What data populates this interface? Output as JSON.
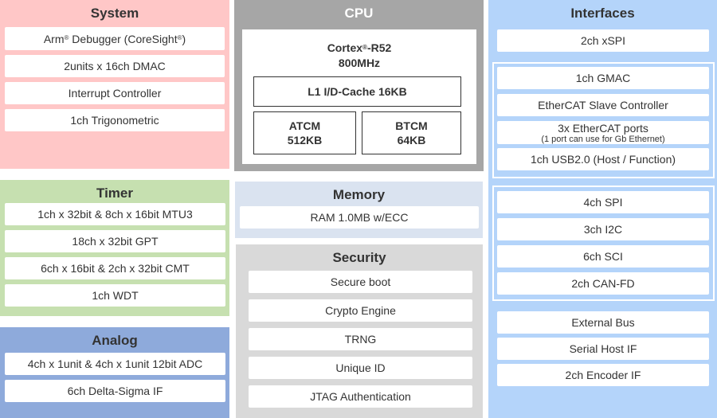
{
  "system": {
    "title": "System",
    "items": [
      {
        "text": "Arm",
        "sup1": "®",
        "rest": " Debugger (CoreSight",
        "sup2": "®",
        "end": ")"
      },
      {
        "label": "2units x 16ch DMAC"
      },
      {
        "label": "Interrupt Controller"
      },
      {
        "label": "1ch Trigonometric"
      }
    ],
    "color": "#ffc7c7"
  },
  "timer": {
    "title": "Timer",
    "items": [
      {
        "label": "1ch x 32bit & 8ch x 16bit MTU3"
      },
      {
        "label": "18ch x 32bit GPT"
      },
      {
        "label": "6ch x 16bit & 2ch x 32bit CMT"
      },
      {
        "label": "1ch WDT"
      }
    ],
    "color": "#c6e0b0"
  },
  "analog": {
    "title": "Analog",
    "items": [
      {
        "label": "4ch x 1unit & 4ch x 1unit 12bit ADC"
      },
      {
        "label": "6ch Delta-Sigma IF"
      }
    ],
    "color": "#8eaadb"
  },
  "cpu": {
    "title": "CPU",
    "core_name": "Cortex",
    "core_sup": "®",
    "core_suffix": "-R52",
    "frequency": "800MHz",
    "cache": "L1 I/D-Cache 16KB",
    "atcm": {
      "name": "ATCM",
      "size": "512KB"
    },
    "btcm": {
      "name": "BTCM",
      "size": "64KB"
    },
    "color": "#a6a6a6"
  },
  "memory": {
    "title": "Memory",
    "items": [
      {
        "label": "RAM 1.0MB w/ECC"
      }
    ],
    "color": "#dae3f0"
  },
  "security": {
    "title": "Security",
    "items": [
      {
        "label": "Secure boot"
      },
      {
        "label": "Crypto Engine"
      },
      {
        "label": "TRNG"
      },
      {
        "label": "Unique ID"
      },
      {
        "label": "JTAG Authentication"
      }
    ],
    "color": "#d9d9d9"
  },
  "interfaces": {
    "title": "Interfaces",
    "standalone_top": [
      {
        "label": "2ch xSPI"
      }
    ],
    "ethernet_group": [
      {
        "label": "1ch GMAC"
      },
      {
        "label": "EtherCAT Slave Controller"
      },
      {
        "label": "3x EtherCAT ports",
        "note": "(1 port can use for Gb Ethernet)"
      },
      {
        "label": "1ch USB2.0 (Host / Function)"
      }
    ],
    "serial_group": [
      {
        "label": "4ch SPI"
      },
      {
        "label": "3ch I2C"
      },
      {
        "label": "6ch SCI"
      },
      {
        "label": "2ch CAN-FD"
      }
    ],
    "standalone_bottom": [
      {
        "label": "External Bus"
      },
      {
        "label": "Serial Host IF"
      },
      {
        "label": "2ch Encoder IF"
      }
    ],
    "color": "#b4d4fa"
  }
}
